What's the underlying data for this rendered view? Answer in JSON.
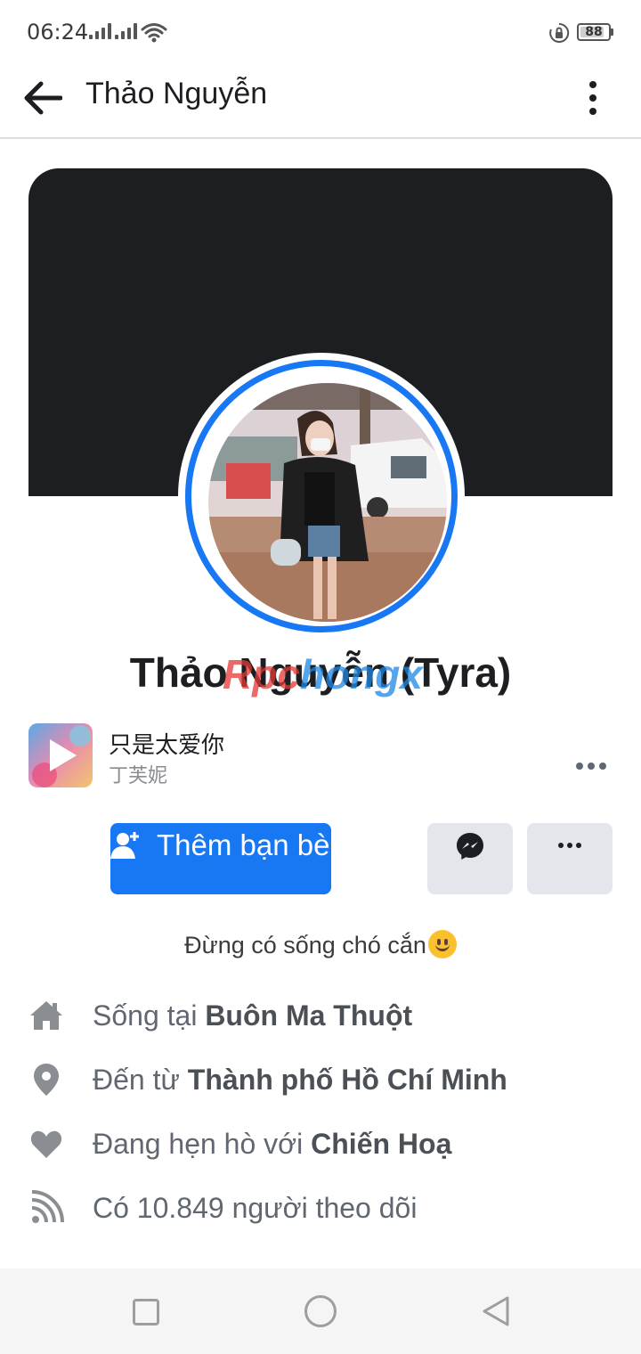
{
  "status_bar": {
    "time": "06:24",
    "battery": "88",
    "battery_level": 0.88,
    "icons": [
      "signal-1-icon",
      "signal-2-icon",
      "wifi-icon",
      "rotation-lock-icon",
      "battery-icon"
    ]
  },
  "header": {
    "title": "Thảo Nguyễn",
    "back_icon": "arrow-left-icon",
    "menu_icon": "more-vertical-icon"
  },
  "profile": {
    "name": "Thảo Nguyễn (Tyra)",
    "watermark": {
      "part1": "Rpc",
      "part2": "hongx"
    },
    "colors": {
      "accent": "#1877f2",
      "cover": "#1c1e21"
    }
  },
  "music": {
    "title": "只是太爱你",
    "artist": "丁芙妮",
    "thumb_icon": "play-icon",
    "more_icon": "more-horizontal-icon"
  },
  "actions": {
    "add_friend_label": "Thêm bạn bè",
    "add_friend_icon": "add-friend-icon",
    "message_icon": "messenger-icon",
    "more_icon": "more-horizontal-icon"
  },
  "bio": {
    "text": "Đừng có sống chó cắn"
  },
  "details": [
    {
      "icon": "home-icon",
      "prefix": "Sống tại ",
      "bold": "Buôn Ma Thuột"
    },
    {
      "icon": "location-pin-icon",
      "prefix": "Đến từ ",
      "bold": "Thành phố Hồ Chí Minh"
    },
    {
      "icon": "heart-icon",
      "prefix": "Đang hẹn hò với ",
      "bold": "Chiến Hoạ"
    },
    {
      "icon": "rss-icon",
      "prefix": "Có 10.849 người theo dõi",
      "bold": ""
    }
  ],
  "navbar": {
    "icons": [
      "recent-apps-icon",
      "home-circle-icon",
      "back-triangle-icon"
    ]
  }
}
